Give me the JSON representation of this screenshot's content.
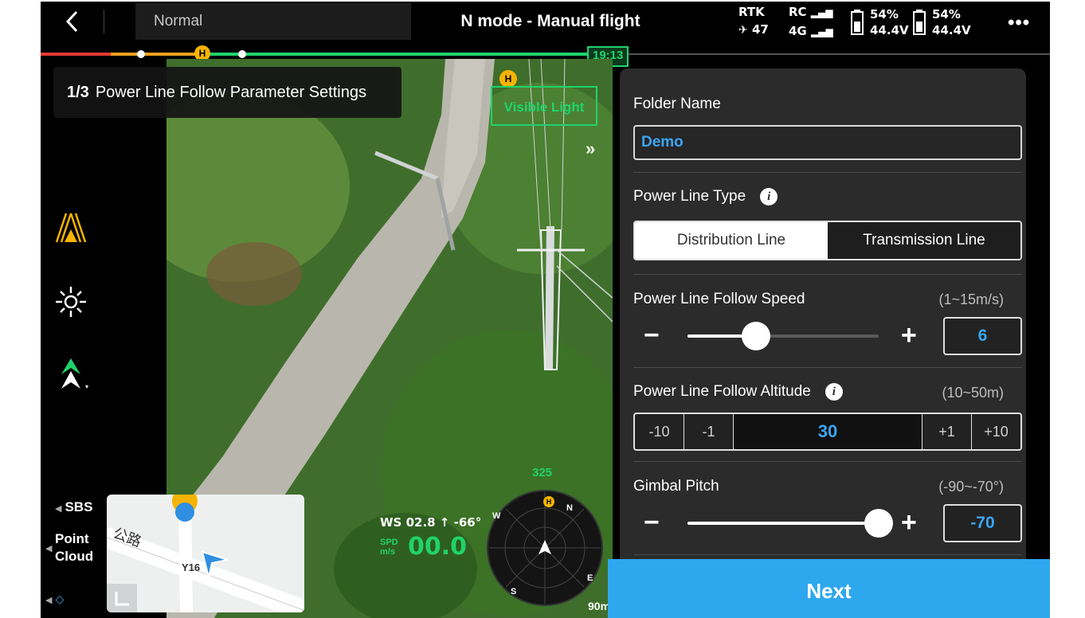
{
  "topbar": {
    "mode": "Normal",
    "title": "N mode - Manual flight",
    "rtk_label": "RTK",
    "rtk_satellites": "47",
    "rc_label": "RC",
    "network_label": "4G",
    "battery1_percent": "54%",
    "battery1_voltage": "44.4V",
    "battery2_percent": "54%",
    "battery2_voltage": "44.4V",
    "more": "•••"
  },
  "timeline": {
    "home_marker": "H",
    "time": "19:13"
  },
  "overlay": {
    "step": "1/3",
    "step_title": "Power Line Follow Parameter Settings",
    "visible_light": "Visible Light",
    "h_marker": "H",
    "collapse": "»"
  },
  "left_rail": {
    "sbs": "SBS",
    "point_cloud_line1": "Point",
    "point_cloud_line2": "Cloud"
  },
  "minimap": {
    "road_label": "Y16",
    "road_name": "公路"
  },
  "telemetry": {
    "wind": "WS 02.8 ↑ -66°",
    "spd_label_1": "SPD",
    "spd_label_2": "m/s",
    "speed": "00.0",
    "heading": "325",
    "altitude": "90m",
    "compass_n": "N",
    "compass_e": "E",
    "compass_s": "S",
    "compass_w": "W",
    "compass_h": "H"
  },
  "panel": {
    "folder_name_label": "Folder Name",
    "folder_name_value": "Demo",
    "power_line_type_label": "Power Line Type",
    "type_options": [
      "Distribution Line",
      "Transmission Line"
    ],
    "type_selected": "Distribution Line",
    "speed_label": "Power Line Follow Speed",
    "speed_range": "(1~15m/s)",
    "speed_value": "6",
    "speed_fraction": 0.36,
    "altitude_label": "Power Line Follow Altitude",
    "altitude_range": "(10~50m)",
    "altitude_value": "30",
    "altitude_steps": [
      "-10",
      "-1",
      "+1",
      "+10"
    ],
    "gimbal_label": "Gimbal Pitch",
    "gimbal_range": "(-90~-70°)",
    "gimbal_value": "-70",
    "gimbal_fraction": 1.0,
    "minus": "−",
    "plus": "+",
    "info": "i"
  },
  "next_button": "Next",
  "colors": {
    "accent_blue": "#2ea7ef",
    "value_blue": "#3aa6f5",
    "hud_green": "#1fd36b",
    "home_yellow": "#f5b400"
  }
}
